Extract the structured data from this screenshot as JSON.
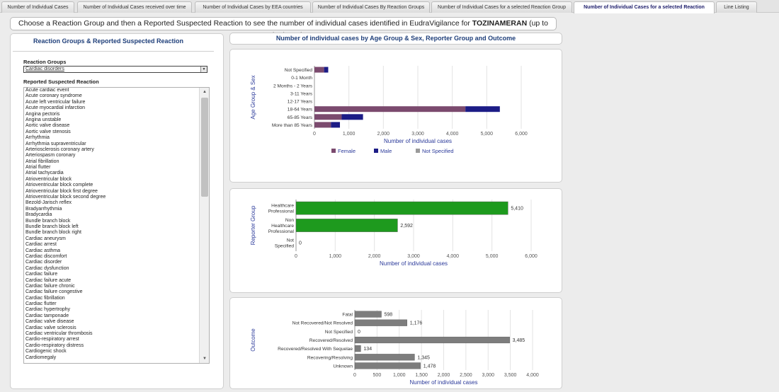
{
  "tabs": [
    {
      "label": "Number of Individual Cases"
    },
    {
      "label": "Number of Individual Cases received over time"
    },
    {
      "label": "Number of Individual Cases by EEA countries"
    },
    {
      "label": "Number of Individual Cases By Reaction Groups"
    },
    {
      "label": "Number of Individual Cases for a selected Reaction Group"
    },
    {
      "label": "Number of Individual Cases for a selected Reaction"
    },
    {
      "label": "Line Listing"
    }
  ],
  "active_tab": 5,
  "instruction": {
    "prefix": "Choose a Reaction Group and then a Reported Suspected Reaction to see the number of individual cases identified in EudraVigilance for ",
    "product": "TOZINAMERAN",
    "suffix": " (up to 01/05/2021)"
  },
  "left_panel": {
    "title": "Reaction Groups & Reported Suspected Reaction",
    "reaction_groups_label": "Reaction Groups",
    "reaction_groups_value": "Cardiac disorders",
    "reported_reaction_label": "Reported Suspected Reaction",
    "reactions": [
      "Acute cardiac event",
      "Acute coronary syndrome",
      "Acute left ventricular failure",
      "Acute myocardial infarction",
      "Angina pectoris",
      "Angina unstable",
      "Aortic valve disease",
      "Aortic valve stenosis",
      "Arrhythmia",
      "Arrhythmia supraventricular",
      "Arteriosclerosis coronary artery",
      "Arteriospasm coronary",
      "Atrial fibrillation",
      "Atrial flutter",
      "Atrial tachycardia",
      "Atrioventricular block",
      "Atrioventricular block complete",
      "Atrioventricular block first degree",
      "Atrioventricular block second degree",
      "Bezold-Jarisch reflex",
      "Bradyarrhythmia",
      "Bradycardia",
      "Bundle branch block",
      "Bundle branch block left",
      "Bundle branch block right",
      "Cardiac aneurysm",
      "Cardiac arrest",
      "Cardiac asthma",
      "Cardiac discomfort",
      "Cardiac disorder",
      "Cardiac dysfunction",
      "Cardiac failure",
      "Cardiac failure acute",
      "Cardiac failure chronic",
      "Cardiac failure congestive",
      "Cardiac fibrillation",
      "Cardiac flutter",
      "Cardiac hypertrophy",
      "Cardiac tamponade",
      "Cardiac valve disease",
      "Cardiac valve sclerosis",
      "Cardiac ventricular thrombosis",
      "Cardio-respiratory arrest",
      "Cardio-respiratory distress",
      "Cardiogenic shock",
      "Cardiomegaly"
    ]
  },
  "right_header": "Number of individual cases by Age Group & Sex, Reporter Group and Outcome",
  "icons": {
    "dropdown": "chevron-down-icon",
    "scroll_up": "chevron-up-icon",
    "scroll_down": "chevron-down-icon"
  },
  "colors": {
    "female": "#7b4a6e",
    "male": "#1c1c86",
    "not_specified": "#9a9a9a",
    "reporter": "#1e9a1e",
    "outcome": "#7d7d7d",
    "axis_label": "#2b3a9a"
  },
  "chart_data": [
    {
      "type": "bar",
      "orientation": "horizontal",
      "stacked": true,
      "categories": [
        "Not Specified",
        "0-1 Month",
        "2 Months - 2 Years",
        "3-11 Years",
        "12-17 Years",
        "18-64 Years",
        "65-85 Years",
        "More than 85 Years"
      ],
      "series": [
        {
          "name": "Female",
          "values": [
            280,
            0,
            0,
            0,
            0,
            4380,
            790,
            480
          ]
        },
        {
          "name": "Male",
          "values": [
            120,
            0,
            0,
            0,
            0,
            1000,
            620,
            260
          ]
        },
        {
          "name": "Not Specified",
          "values": [
            0,
            0,
            0,
            0,
            0,
            0,
            0,
            0
          ]
        }
      ],
      "xlabel": "Number of individual cases",
      "ylabel": "Age Group & Sex",
      "xlim": [
        0,
        6000
      ],
      "xticks": [
        "0",
        "1,000",
        "2,000",
        "3,000",
        "4,000",
        "5,000",
        "6,000"
      ],
      "legend": "bottom",
      "grid": true
    },
    {
      "type": "bar",
      "orientation": "horizontal",
      "categories": [
        "Healthcare Professional",
        "Non Healthcare Professional",
        "Not Specified"
      ],
      "values": [
        5410,
        2592,
        0
      ],
      "data_labels": [
        "5,410",
        "2,592",
        "0"
      ],
      "xlabel": "Number of individual cases",
      "ylabel": "Reporter Group",
      "xlim": [
        0,
        6000
      ],
      "xticks": [
        "0",
        "1,000",
        "2,000",
        "3,000",
        "4,000",
        "5,000",
        "6,000"
      ],
      "grid": true
    },
    {
      "type": "bar",
      "orientation": "horizontal",
      "categories": [
        "Fatal",
        "Not Recovered/Not Resolved",
        "Not Specified",
        "Recovered/Resolved",
        "Recovered/Resolved With Sequelae",
        "Recovering/Resolving",
        "Unknown"
      ],
      "values": [
        598,
        1176,
        0,
        3485,
        134,
        1345,
        1478
      ],
      "data_labels": [
        "598",
        "1,176",
        "0",
        "3,485",
        "134",
        "1,345",
        "1,478"
      ],
      "xlabel": "Number of individual cases",
      "ylabel": "Outcome",
      "xlim": [
        0,
        4000
      ],
      "xticks": [
        "0",
        "500",
        "1,000",
        "1,500",
        "2,000",
        "2,500",
        "3,000",
        "3,500",
        "4,000"
      ],
      "grid": true
    }
  ]
}
